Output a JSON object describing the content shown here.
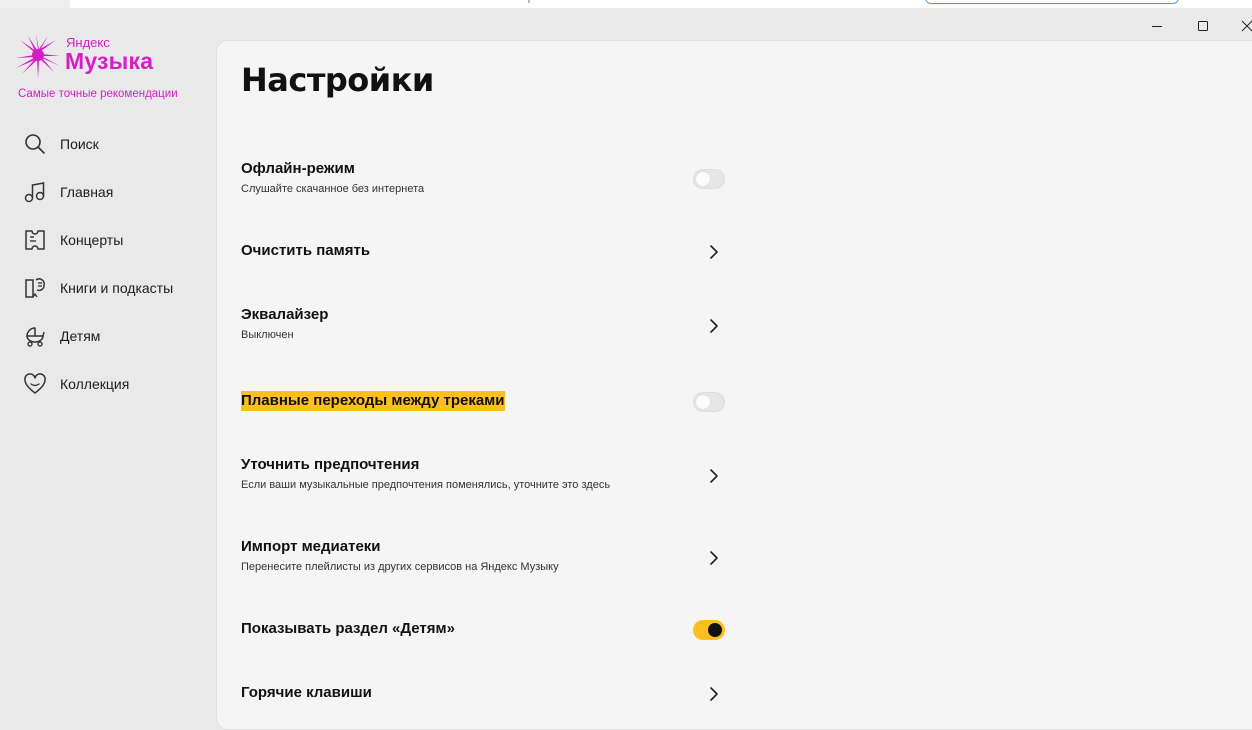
{
  "window": {
    "minimize_icon": "minimize-icon",
    "maximize_icon": "maximize-icon",
    "close_icon": "close-icon"
  },
  "brand": {
    "small": "Яндекс",
    "big": "Музыка",
    "slogan": "Самые точные рекомендации",
    "color": "#d41ec8"
  },
  "sidebar": {
    "items": [
      {
        "label": "Поиск",
        "icon": "search-icon"
      },
      {
        "label": "Главная",
        "icon": "music-note-icon"
      },
      {
        "label": "Концерты",
        "icon": "ticket-icon"
      },
      {
        "label": "Книги и подкасты",
        "icon": "book-icon"
      },
      {
        "label": "Детям",
        "icon": "stroller-icon"
      },
      {
        "label": "Коллекция",
        "icon": "heart-icon"
      }
    ]
  },
  "page": {
    "title": "Настройки"
  },
  "settings": [
    {
      "title": "Офлайн-режим",
      "subtitle": "Слушайте скачанное без интернета",
      "control": "toggle",
      "state": false
    },
    {
      "title": "Очистить память",
      "subtitle": "",
      "control": "chevron"
    },
    {
      "title": "Эквалайзер",
      "subtitle": "Выключен",
      "control": "chevron"
    },
    {
      "title": "Плавные переходы между треками",
      "subtitle": "",
      "control": "toggle",
      "state": false,
      "highlighted": true
    },
    {
      "title": "Уточнить предпочтения",
      "subtitle": "Если ваши музыкальные предпочтения поменялись, уточните это здесь",
      "control": "chevron"
    },
    {
      "title": "Импорт медиатеки",
      "subtitle": "Перенесите плейлисты из других сервисов на Яндекс Музыку",
      "control": "chevron"
    },
    {
      "title": "Показывать раздел «Детям»",
      "subtitle": "",
      "control": "toggle",
      "state": true
    },
    {
      "title": "Горячие клавиши",
      "subtitle": "",
      "control": "chevron"
    }
  ],
  "colors": {
    "accent": "#fcbf1e",
    "background": "#e9e9e9",
    "panel": "#f5f5f5"
  }
}
